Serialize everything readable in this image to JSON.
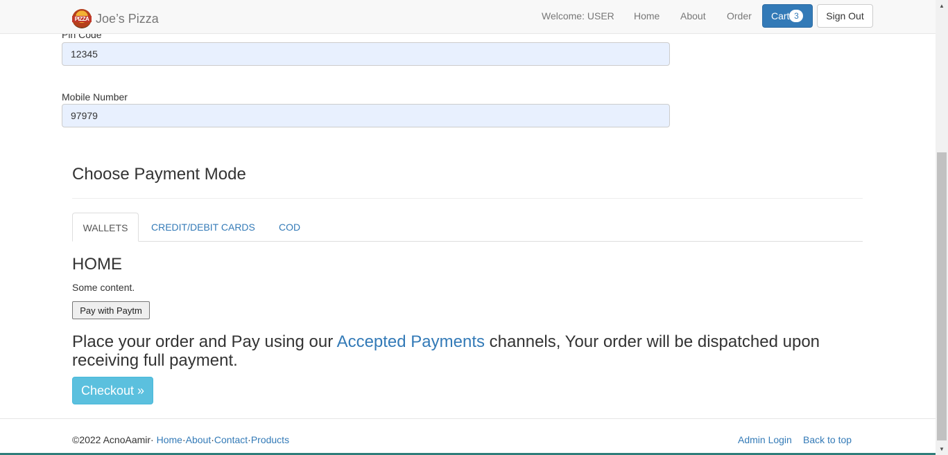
{
  "navbar": {
    "brand_logo_text": "PIZZA",
    "brand_name": "Joe’s Pizza",
    "welcome": "Welcome: USER",
    "home": "Home",
    "about": "About",
    "order": "Order",
    "cart_label": "Cart",
    "cart_count": "3",
    "sign_out": "Sign Out"
  },
  "form": {
    "pin_label": "Pin Code",
    "pin_value": "12345",
    "mobile_label": "Mobile Number",
    "mobile_value": "97979"
  },
  "payment": {
    "title": "Choose Payment Mode",
    "tabs": [
      "WALLETS",
      "CREDIT/DEBIT CARDS",
      "COD"
    ],
    "active_heading": "HOME",
    "active_text": "Some content.",
    "paytm_button": "Pay with Paytm",
    "lead_before": "Place your order and Pay using our ",
    "lead_link": "Accepted Payments",
    "lead_after": " channels, Your order will be dispatched upon receiving full payment.",
    "checkout_button": "Checkout »"
  },
  "footer": {
    "copyright": "©2022 AcnoAamir",
    "links": [
      "Home",
      "About",
      "Contact",
      "Products"
    ],
    "admin_login": "Admin Login",
    "back_to_top": "Back to top"
  },
  "colors": {
    "primary": "#337ab7",
    "info": "#5bc0de",
    "autofill": "#e8f0fe"
  }
}
